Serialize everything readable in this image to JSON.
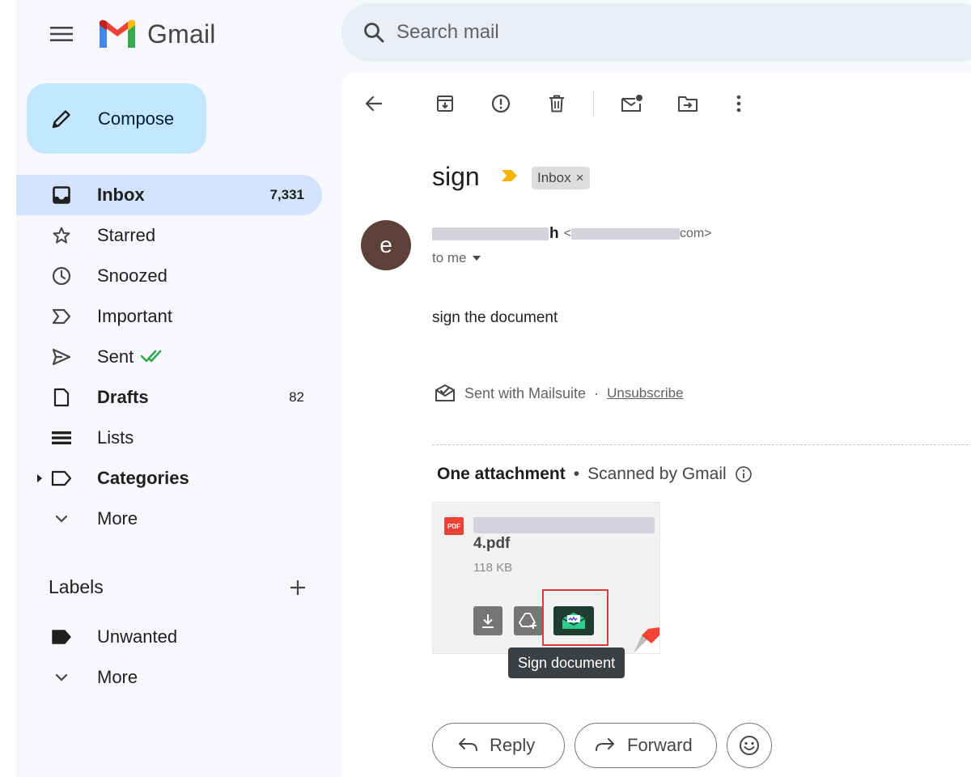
{
  "app": {
    "name": "Gmail",
    "brand_colors": [
      "#4285f4",
      "#34a853",
      "#fbbc04",
      "#ea4335"
    ]
  },
  "search": {
    "placeholder": "Search mail"
  },
  "compose": {
    "label": "Compose"
  },
  "sidebar": {
    "items": [
      {
        "icon": "inbox-icon",
        "label": "Inbox",
        "count": "7,331",
        "active": true,
        "bold": true
      },
      {
        "icon": "star-icon",
        "label": "Starred",
        "count": ""
      },
      {
        "icon": "clock-icon",
        "label": "Snoozed",
        "count": ""
      },
      {
        "icon": "important-icon",
        "label": "Important",
        "count": ""
      },
      {
        "icon": "send-icon",
        "label": "Sent",
        "count": ""
      },
      {
        "icon": "draft-icon",
        "label": "Drafts",
        "count": "82",
        "bold": true
      },
      {
        "icon": "list-icon",
        "label": "Lists",
        "count": ""
      },
      {
        "icon": "label-icon",
        "label": "Categories",
        "count": "",
        "bold": true
      },
      {
        "icon": "chevron-down-icon",
        "label": "More",
        "count": ""
      }
    ],
    "labels_heading": "Labels",
    "labels": [
      {
        "icon": "label-filled-icon",
        "label": "Unwanted"
      },
      {
        "icon": "chevron-down-icon",
        "label": "More"
      }
    ]
  },
  "email": {
    "subject": "sign",
    "chip_label": "Inbox",
    "chip_close": "×",
    "avatar_letter": "e",
    "sender_name_suffix": "h",
    "sender_email_open": "<",
    "sender_email_suffix": "com>",
    "recipient": "to me",
    "body": "sign the document",
    "footer_text": "Sent with Mailsuite",
    "footer_separator": "·",
    "footer_link": "Unsubscribe"
  },
  "attachments": {
    "heading": "One attachment",
    "separator": "•",
    "scanned": "Scanned by Gmail",
    "file": {
      "badge": "PDF",
      "name_visible": "4.pdf",
      "size": "118 KB"
    },
    "tooltip": "Sign document"
  },
  "actions": {
    "reply": "Reply",
    "forward": "Forward"
  }
}
